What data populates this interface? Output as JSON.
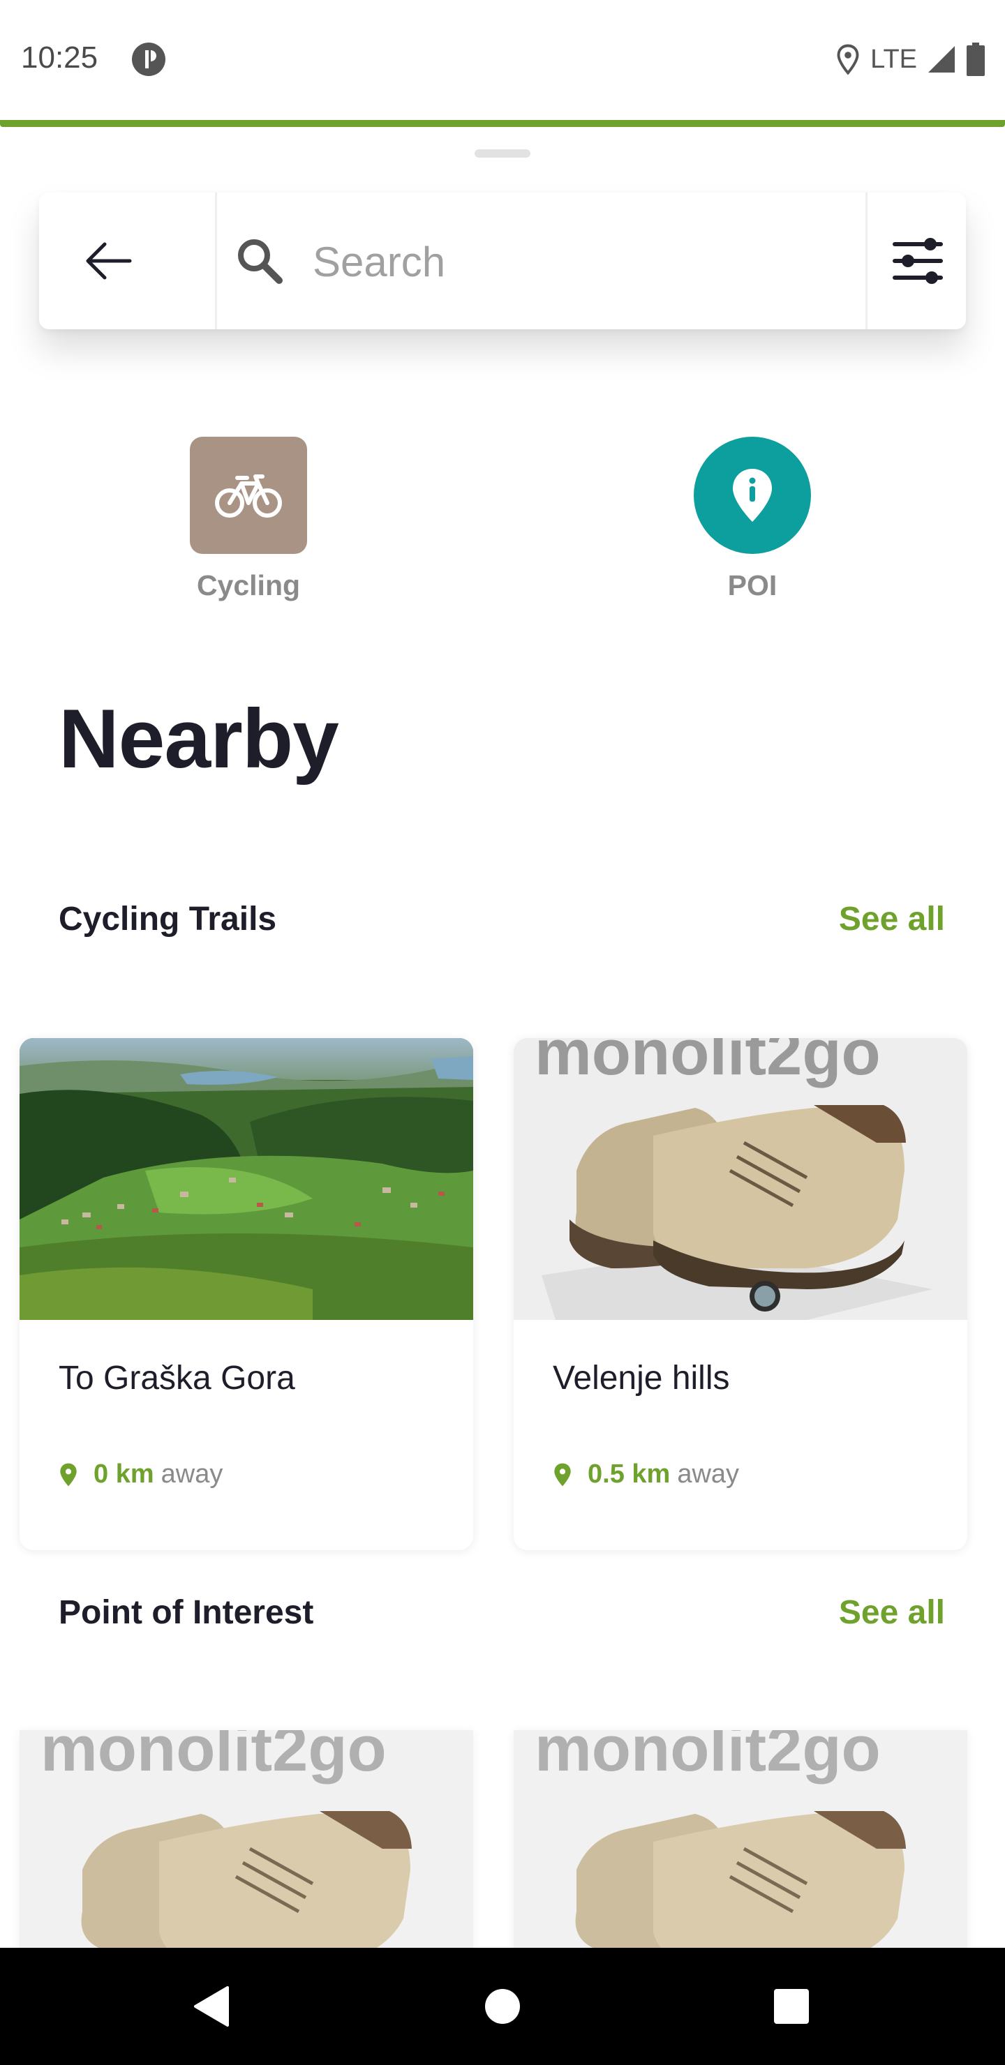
{
  "status_bar": {
    "time": "10:25",
    "network": "LTE"
  },
  "search": {
    "placeholder": "Search"
  },
  "categories": [
    {
      "label": "Cycling",
      "icon": "bicycle-icon",
      "color": "#a99385"
    },
    {
      "label": "POI",
      "icon": "location-info-icon",
      "color": "#0d9e9e"
    }
  ],
  "nearby_title": "Nearby",
  "sections": [
    {
      "title": "Cycling Trails",
      "see_all": "See all",
      "cards": [
        {
          "title": "To Graška Gora",
          "distance": "0 km",
          "away": "away"
        },
        {
          "title": "Velenje hills",
          "distance": "0.5 km",
          "away": "away"
        }
      ]
    },
    {
      "title": "Point of Interest",
      "see_all": "See all"
    }
  ],
  "placeholder_image_text": "monolit2go",
  "colors": {
    "accent": "#6ea22c",
    "teal": "#0d9e9e",
    "cycling": "#a99385",
    "text": "#1e1e2a"
  }
}
